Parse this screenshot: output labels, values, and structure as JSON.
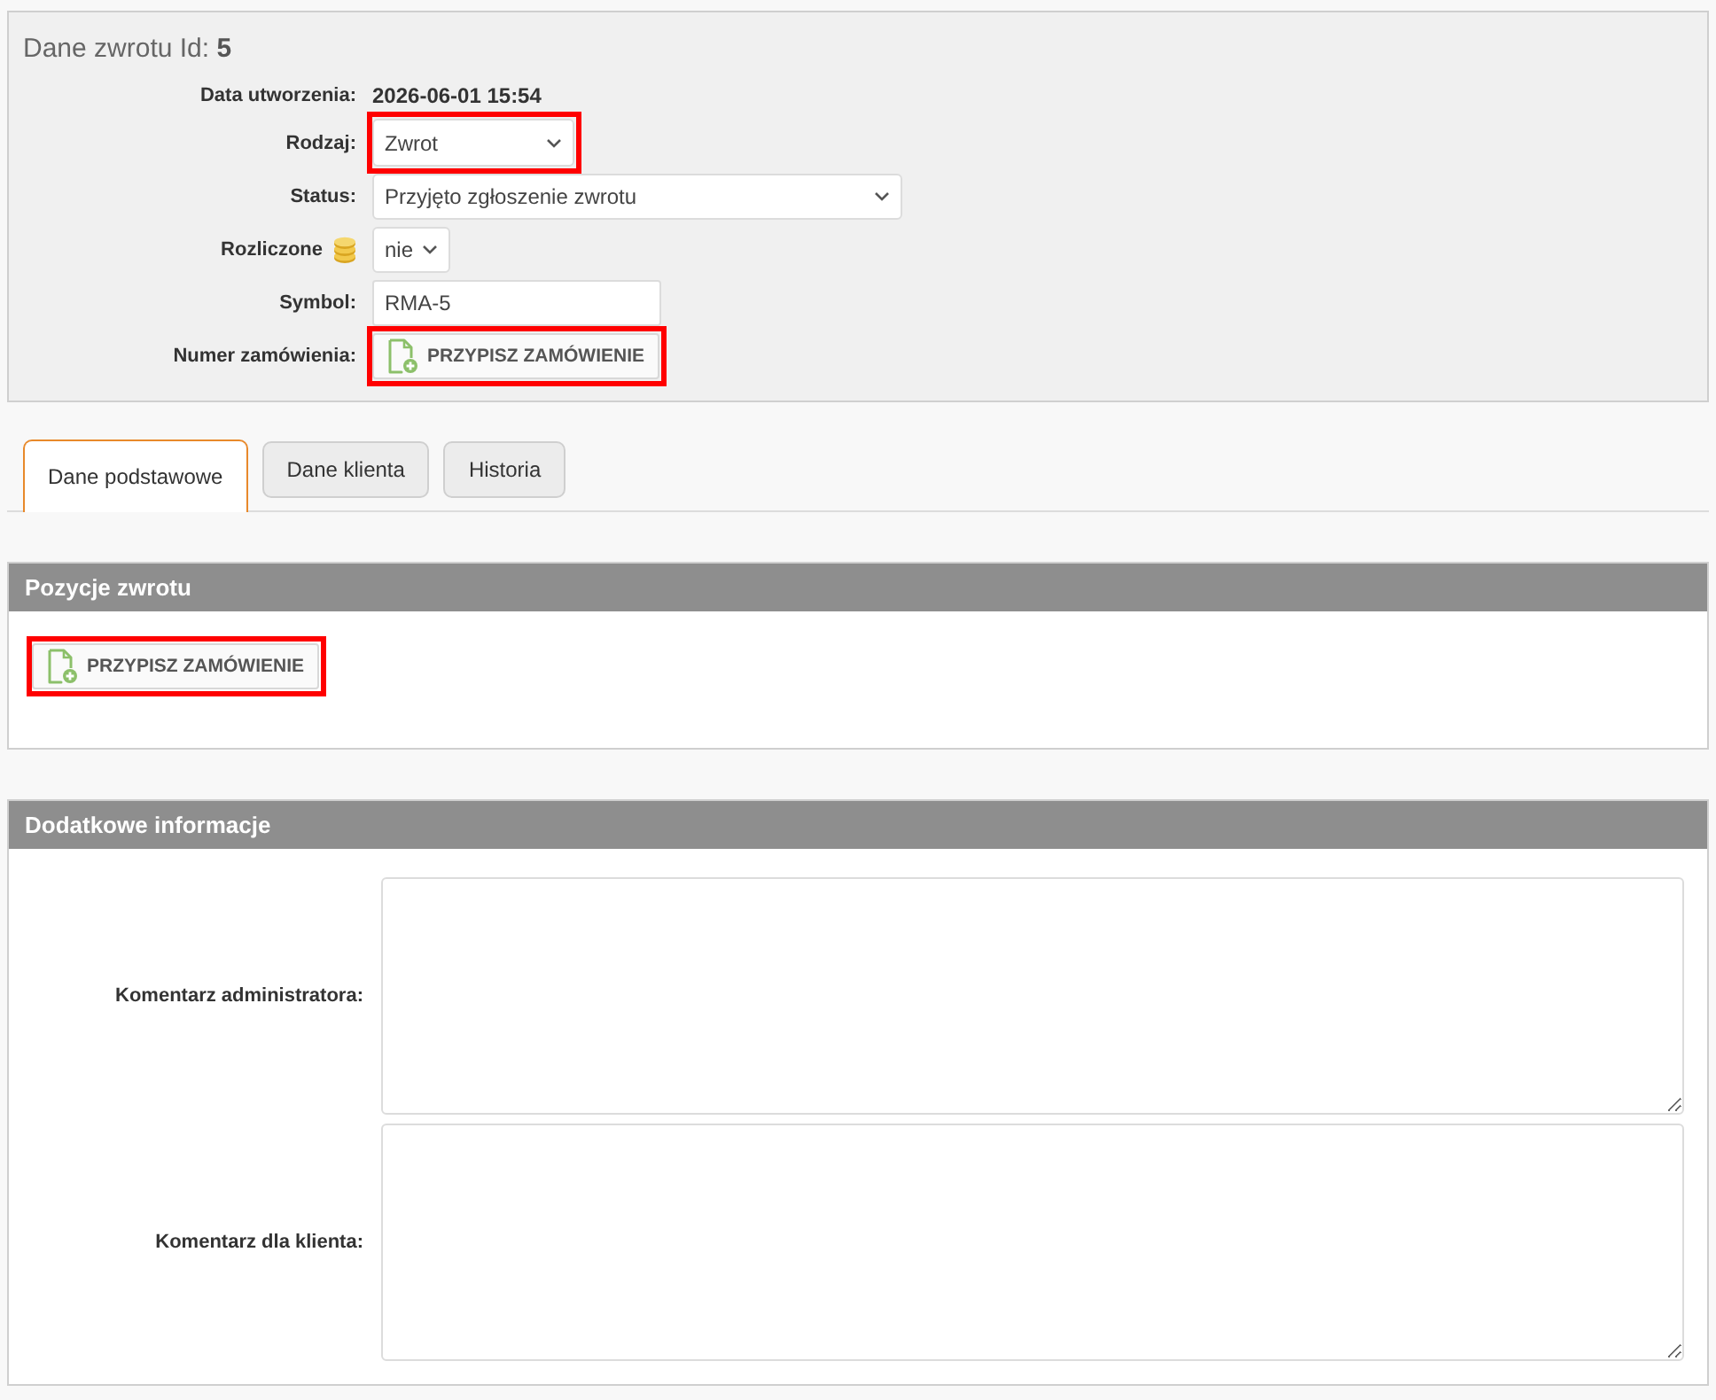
{
  "panel": {
    "title": "Dane zwrotu Id: **5**"
  },
  "form": {
    "rows": [
      {
        "kind": "text",
        "label": "Data utworzenia:",
        "value": "2026-06-01 15:54"
      },
      {
        "kind": "select",
        "label": "Rodzaj:",
        "value": "Zwrot",
        "highlighted": true
      },
      {
        "kind": "select",
        "label": "Status:",
        "value": "Przyjęto zgłoszenie zwrotu"
      },
      {
        "kind": "select",
        "label": "Rozliczone",
        "label_icon": true,
        "value": "nie"
      },
      {
        "kind": "input",
        "label": "Symbol:",
        "value": "RMA-5"
      },
      {
        "kind": "button",
        "label": "Numer zamówienia:",
        "value": "PRZYPISZ ZAMÓWIENIE",
        "highlighted": true
      }
    ]
  },
  "tabs": [
    {
      "label": "Dane podstawowe",
      "selected": true
    },
    {
      "label": "Dane klienta",
      "selected": false
    },
    {
      "label": "Historia",
      "selected": false
    }
  ],
  "positions_section": {
    "title": "Pozycje zwrotu",
    "button": {
      "label": "PRZYPISZ ZAMÓWIENIE",
      "highlighted": true
    }
  },
  "additional_section": {
    "title": "Dodatkowe informacje",
    "fields": [
      {
        "label": "Komentarz administratora:"
      },
      {
        "label": "Komentarz dla klienta:"
      }
    ]
  }
}
